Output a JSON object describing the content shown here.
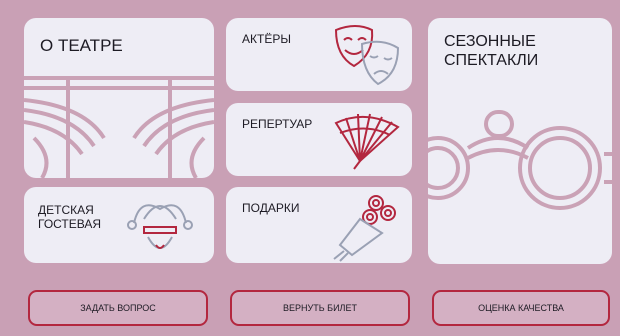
{
  "tiles": {
    "about": {
      "label": "О ТЕАТРЕ"
    },
    "actors": {
      "label": "АКТЁРЫ"
    },
    "repertoire": {
      "label": "РЕПЕРТУАР"
    },
    "seasonal": {
      "label": "СЕЗОННЫЕ\nСПЕКТАКЛИ"
    },
    "kids": {
      "label": "ДЕТСКАЯ\nГОСТЕВАЯ"
    },
    "gifts": {
      "label": "ПОДАРКИ"
    }
  },
  "buttons": {
    "ask": "ЗАДАТЬ ВОПРОС",
    "refund": "ВЕРНУТЬ БИЛЕТ",
    "rating": "ОЦЕНКА КАЧЕСТВА"
  },
  "colors": {
    "background": "#c9a0b5",
    "tile": "#eeedf5",
    "accent_red": "#b3273f",
    "decor_pink": "#caa2b6",
    "icon_grey": "#9aa1b4"
  },
  "icons": {
    "actors": "theatre-masks-icon",
    "repertoire": "hand-fan-icon",
    "kids": "jester-icon",
    "gifts": "flower-bouquet-icon",
    "about": "stage-curtain-decor",
    "seasonal": "opera-glasses-decor"
  }
}
